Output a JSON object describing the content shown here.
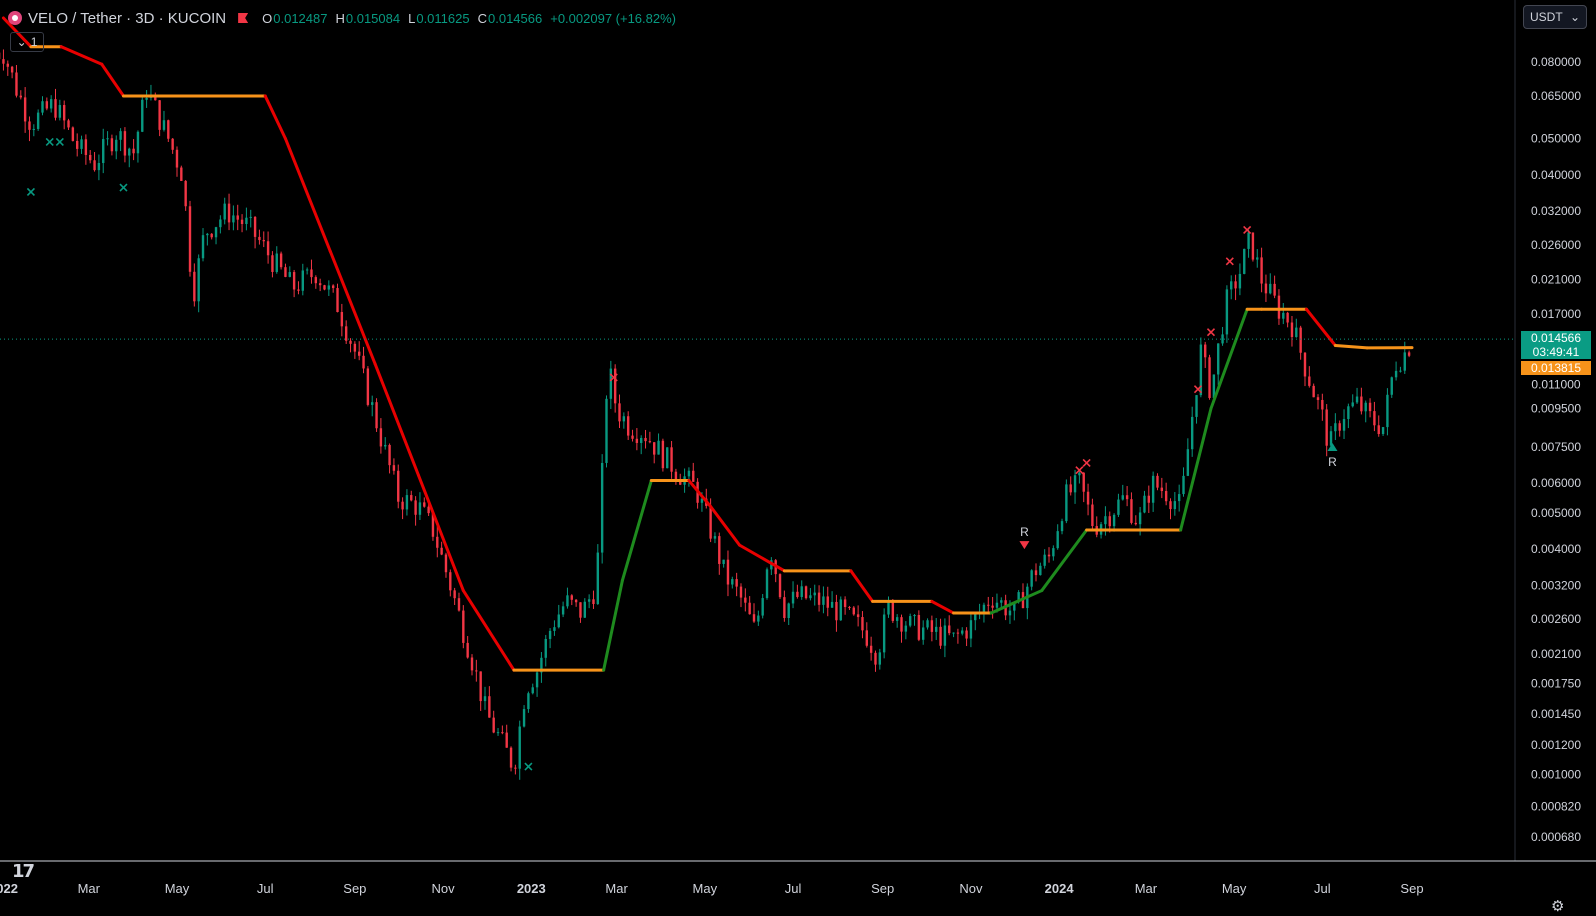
{
  "header": {
    "title": "VELO / Tether · 3D · KUCOIN",
    "ohlc": [
      {
        "k": "O",
        "v": "0.012487"
      },
      {
        "k": "H",
        "v": "0.015084"
      },
      {
        "k": "L",
        "v": "0.011625"
      },
      {
        "k": "C",
        "v": "0.014566"
      }
    ],
    "change": "+0.002097 (+16.82%)",
    "interval_count": "1",
    "currency_select": "USDT"
  },
  "last_price": {
    "value": "0.014566",
    "countdown": "03:49:41",
    "indicator_value": "0.013815",
    "color_price": "#0a9c84",
    "color_indicator": "#f7931a"
  },
  "icons": {
    "tv_logo": "tradingview-logo-icon",
    "settings": "gear-icon",
    "collapse": "chevron-down-icon"
  },
  "colors": {
    "up": "#089981",
    "down": "#f23645",
    "line_up": "#1e8b1e",
    "line_down": "#e80000",
    "line_flat": "#f7931a"
  },
  "chart_data": {
    "type": "candlestick",
    "scale": "log",
    "symbol": "VELO / Tether",
    "interval": "3D",
    "exchange": "KUCOIN",
    "ylim": [
      0.00066,
      0.105
    ],
    "y_ticks": [
      "0.080000",
      "0.065000",
      "0.050000",
      "0.040000",
      "0.032000",
      "0.026000",
      "0.021000",
      "0.017000",
      "0.011000",
      "0.009500",
      "0.007500",
      "0.006000",
      "0.005000",
      "0.004000",
      "0.003200",
      "0.002600",
      "0.002100",
      "0.001750",
      "0.001450",
      "0.001200",
      "0.001000",
      "0.000820",
      "0.000680"
    ],
    "x_ticks": [
      "2022",
      "Mar",
      "May",
      "Jul",
      "Sep",
      "Nov",
      "2023",
      "Mar",
      "May",
      "Jul",
      "Sep",
      "Nov",
      "2024",
      "Mar",
      "May",
      "Jul",
      "Sep"
    ],
    "x_tick_dates": [
      "2022-01-01",
      "2022-03-01",
      "2022-05-01",
      "2022-07-01",
      "2022-09-01",
      "2022-11-01",
      "2023-01-01",
      "2023-03-01",
      "2023-05-01",
      "2023-07-01",
      "2023-09-01",
      "2023-11-01",
      "2024-01-01",
      "2024-03-01",
      "2024-05-01",
      "2024-07-01",
      "2024-09-01"
    ],
    "close_path": [
      [
        "2022-01-01",
        0.085
      ],
      [
        "2022-01-10",
        0.068
      ],
      [
        "2022-01-20",
        0.055
      ],
      [
        "2022-02-05",
        0.062
      ],
      [
        "2022-02-20",
        0.048
      ],
      [
        "2022-03-05",
        0.043
      ],
      [
        "2022-03-20",
        0.052
      ],
      [
        "2022-04-01",
        0.046
      ],
      [
        "2022-04-10",
        0.068
      ],
      [
        "2022-04-25",
        0.05
      ],
      [
        "2022-05-05",
        0.04
      ],
      [
        "2022-05-12",
        0.019
      ],
      [
        "2022-05-20",
        0.028
      ],
      [
        "2022-06-05",
        0.032
      ],
      [
        "2022-06-20",
        0.029
      ],
      [
        "2022-07-05",
        0.024
      ],
      [
        "2022-07-20",
        0.02
      ],
      [
        "2022-08-05",
        0.022
      ],
      [
        "2022-08-20",
        0.018
      ],
      [
        "2022-09-01",
        0.0135
      ],
      [
        "2022-09-15",
        0.009
      ],
      [
        "2022-10-01",
        0.0055
      ],
      [
        "2022-10-15",
        0.0052
      ],
      [
        "2022-10-25",
        0.0045
      ],
      [
        "2022-11-05",
        0.0033
      ],
      [
        "2022-11-20",
        0.0021
      ],
      [
        "2022-12-01",
        0.00145
      ],
      [
        "2022-12-10",
        0.00125
      ],
      [
        "2022-12-20",
        0.00105
      ],
      [
        "2022-12-28",
        0.0017
      ],
      [
        "2023-01-05",
        0.0019
      ],
      [
        "2023-01-15",
        0.0025
      ],
      [
        "2023-01-25",
        0.0029
      ],
      [
        "2023-02-05",
        0.0027
      ],
      [
        "2023-02-15",
        0.0032
      ],
      [
        "2023-02-23",
        0.0125
      ],
      [
        "2023-03-01",
        0.0095
      ],
      [
        "2023-03-10",
        0.0085
      ],
      [
        "2023-03-20",
        0.0082
      ],
      [
        "2023-04-01",
        0.0072
      ],
      [
        "2023-04-15",
        0.0063
      ],
      [
        "2023-04-25",
        0.0058
      ],
      [
        "2023-05-05",
        0.0045
      ],
      [
        "2023-05-15",
        0.0034
      ],
      [
        "2023-05-25",
        0.003
      ],
      [
        "2023-06-05",
        0.0024
      ],
      [
        "2023-06-15",
        0.0041
      ],
      [
        "2023-06-25",
        0.0028
      ],
      [
        "2023-07-05",
        0.003
      ],
      [
        "2023-07-20",
        0.0029
      ],
      [
        "2023-08-05",
        0.0027
      ],
      [
        "2023-08-20",
        0.0024
      ],
      [
        "2023-08-28",
        0.0021
      ],
      [
        "2023-09-05",
        0.0028
      ],
      [
        "2023-09-20",
        0.0025
      ],
      [
        "2023-10-05",
        0.0024
      ],
      [
        "2023-10-20",
        0.0023
      ],
      [
        "2023-11-01",
        0.0025
      ],
      [
        "2023-11-15",
        0.003
      ],
      [
        "2023-12-01",
        0.0027
      ],
      [
        "2023-12-15",
        0.0035
      ],
      [
        "2023-12-25",
        0.0038
      ],
      [
        "2024-01-05",
        0.0055
      ],
      [
        "2024-01-15",
        0.006
      ],
      [
        "2024-01-25",
        0.0046
      ],
      [
        "2024-02-05",
        0.005
      ],
      [
        "2024-02-15",
        0.0055
      ],
      [
        "2024-02-25",
        0.0047
      ],
      [
        "2024-03-05",
        0.006
      ],
      [
        "2024-03-15",
        0.0057
      ],
      [
        "2024-03-25",
        0.0052
      ],
      [
        "2024-04-01",
        0.0085
      ],
      [
        "2024-04-08",
        0.0135
      ],
      [
        "2024-04-15",
        0.0105
      ],
      [
        "2024-04-25",
        0.018
      ],
      [
        "2024-05-05",
        0.022
      ],
      [
        "2024-05-12",
        0.027
      ],
      [
        "2024-05-20",
        0.021
      ],
      [
        "2024-06-01",
        0.0175
      ],
      [
        "2024-06-10",
        0.016
      ],
      [
        "2024-06-20",
        0.012
      ],
      [
        "2024-07-01",
        0.009
      ],
      [
        "2024-07-06",
        0.0075
      ],
      [
        "2024-07-15",
        0.0092
      ],
      [
        "2024-07-25",
        0.0098
      ],
      [
        "2024-08-05",
        0.0088
      ],
      [
        "2024-08-12",
        0.0085
      ],
      [
        "2024-08-20",
        0.0125
      ],
      [
        "2024-08-28",
        0.0135
      ],
      [
        "2024-09-01",
        0.014566
      ]
    ],
    "trend_line": [
      [
        "2022-01-01",
        0.105,
        "down"
      ],
      [
        "2022-01-20",
        0.088,
        "down"
      ],
      [
        "2022-02-10",
        0.088,
        "flat"
      ],
      [
        "2022-03-10",
        0.079,
        "down"
      ],
      [
        "2022-03-25",
        0.065,
        "down"
      ],
      [
        "2022-07-01",
        0.065,
        "flat"
      ],
      [
        "2022-07-15",
        0.05,
        "down"
      ],
      [
        "2022-08-15",
        0.025,
        "down"
      ],
      [
        "2022-09-15",
        0.0125,
        "down"
      ],
      [
        "2022-10-15",
        0.0063,
        "down"
      ],
      [
        "2022-11-15",
        0.0031,
        "down"
      ],
      [
        "2022-12-20",
        0.0019,
        "down"
      ],
      [
        "2023-02-20",
        0.0019,
        "flat"
      ],
      [
        "2023-03-05",
        0.0033,
        "up"
      ],
      [
        "2023-03-25",
        0.0061,
        "up"
      ],
      [
        "2023-04-20",
        0.0061,
        "flat"
      ],
      [
        "2023-05-05",
        0.0052,
        "down"
      ],
      [
        "2023-05-25",
        0.0041,
        "down"
      ],
      [
        "2023-06-25",
        0.0035,
        "down"
      ],
      [
        "2023-08-10",
        0.0035,
        "flat"
      ],
      [
        "2023-08-25",
        0.0029,
        "down"
      ],
      [
        "2023-10-05",
        0.0029,
        "flat"
      ],
      [
        "2023-10-20",
        0.0027,
        "down"
      ],
      [
        "2023-11-15",
        0.0027,
        "flat"
      ],
      [
        "2023-12-20",
        0.0031,
        "up"
      ],
      [
        "2024-01-20",
        0.0045,
        "up"
      ],
      [
        "2024-03-25",
        0.0045,
        "flat"
      ],
      [
        "2024-04-15",
        0.0095,
        "up"
      ],
      [
        "2024-05-10",
        0.0175,
        "up"
      ],
      [
        "2024-05-20",
        0.0175,
        "flat"
      ],
      [
        "2024-06-20",
        0.0175,
        "flat"
      ],
      [
        "2024-07-10",
        0.014,
        "down"
      ],
      [
        "2024-08-01",
        0.0138,
        "flat"
      ],
      [
        "2024-09-01",
        0.013815,
        "flat"
      ]
    ],
    "signal_markers": [
      {
        "date": "2022-01-20",
        "price": 0.036,
        "type": "cross",
        "color": "#089981"
      },
      {
        "date": "2022-02-02",
        "price": 0.049,
        "type": "cross",
        "color": "#089981"
      },
      {
        "date": "2022-02-09",
        "price": 0.049,
        "type": "cross",
        "color": "#089981"
      },
      {
        "date": "2022-03-25",
        "price": 0.037,
        "type": "cross",
        "color": "#089981"
      },
      {
        "date": "2022-12-30",
        "price": 0.00105,
        "type": "cross",
        "color": "#089981"
      },
      {
        "date": "2023-02-27",
        "price": 0.0115,
        "type": "cross",
        "color": "#f23645"
      },
      {
        "date": "2024-01-15",
        "price": 0.0065,
        "type": "cross",
        "color": "#f23645"
      },
      {
        "date": "2024-01-20",
        "price": 0.0068,
        "type": "cross",
        "color": "#f23645"
      },
      {
        "date": "2024-04-06",
        "price": 0.0107,
        "type": "cross",
        "color": "#f23645"
      },
      {
        "date": "2024-04-15",
        "price": 0.0152,
        "type": "cross",
        "color": "#f23645"
      },
      {
        "date": "2024-04-28",
        "price": 0.0235,
        "type": "cross",
        "color": "#f23645"
      },
      {
        "date": "2024-05-10",
        "price": 0.0285,
        "type": "cross",
        "color": "#f23645"
      }
    ],
    "label_markers": [
      {
        "date": "2023-12-08",
        "price": 0.0041,
        "shape": "triangle-down",
        "color": "#f23645",
        "text": "R"
      },
      {
        "date": "2024-07-08",
        "price": 0.0075,
        "shape": "triangle-up",
        "color": "#089981",
        "text": "R"
      }
    ]
  }
}
